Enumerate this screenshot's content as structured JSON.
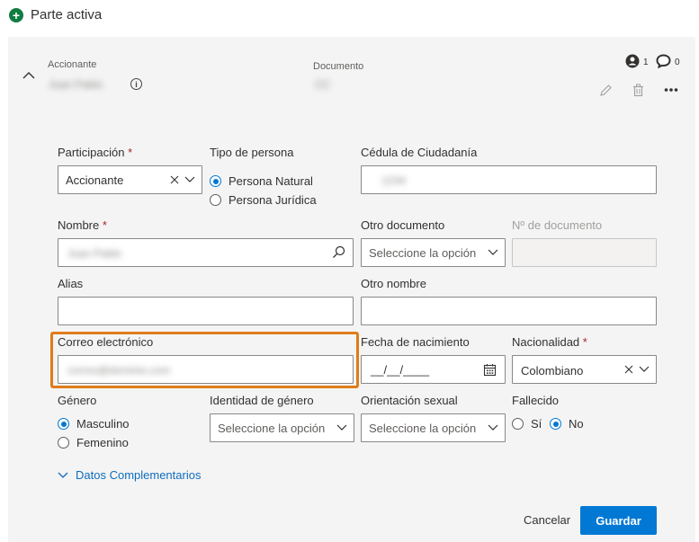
{
  "section": {
    "title": "Parte activa",
    "icon": "plus-circle-icon"
  },
  "header": {
    "role_label": "Accionante",
    "role_value": "Juan Pablo",
    "document_label": "Documento",
    "document_value": "CC",
    "user_count": "1",
    "comment_count": "0"
  },
  "form": {
    "participacion": {
      "label": "Participación",
      "required": "*",
      "value": "Accionante"
    },
    "tipo_persona": {
      "label": "Tipo de persona",
      "options": [
        "Persona Natural",
        "Persona Jurídica"
      ],
      "selected": "Persona Natural"
    },
    "cedula": {
      "label": "Cédula de Ciudadanía",
      "value": "1234"
    },
    "nombre": {
      "label": "Nombre",
      "required": "*",
      "value": "Juan Pablo"
    },
    "otro_documento": {
      "label": "Otro documento",
      "placeholder": "Seleccione la opción"
    },
    "numero_documento": {
      "label": "Nº de documento"
    },
    "alias": {
      "label": "Alias",
      "value": ""
    },
    "otro_nombre": {
      "label": "Otro nombre",
      "value": ""
    },
    "correo": {
      "label": "Correo electrónico",
      "value": "correo@dominio.com"
    },
    "fecha_nacimiento": {
      "label": "Fecha de nacimiento",
      "placeholder": "__/__/____"
    },
    "nacionalidad": {
      "label": "Nacionalidad",
      "required": "*",
      "value": "Colombiano"
    },
    "genero": {
      "label": "Género",
      "options": [
        "Masculino",
        "Femenino"
      ],
      "selected": "Masculino"
    },
    "identidad_genero": {
      "label": "Identidad de género",
      "placeholder": "Seleccione la opción"
    },
    "orientacion_sexual": {
      "label": "Orientación sexual",
      "placeholder": "Seleccione la opción"
    },
    "fallecido": {
      "label": "Fallecido",
      "options": [
        "Sí",
        "No"
      ],
      "selected": "No"
    },
    "complementarios": {
      "label": "Datos Complementarios"
    }
  },
  "actions": {
    "cancel": "Cancelar",
    "save": "Guardar"
  },
  "colors": {
    "accent": "#0078d4",
    "highlight": "#e07b1a",
    "add": "#107c41"
  }
}
